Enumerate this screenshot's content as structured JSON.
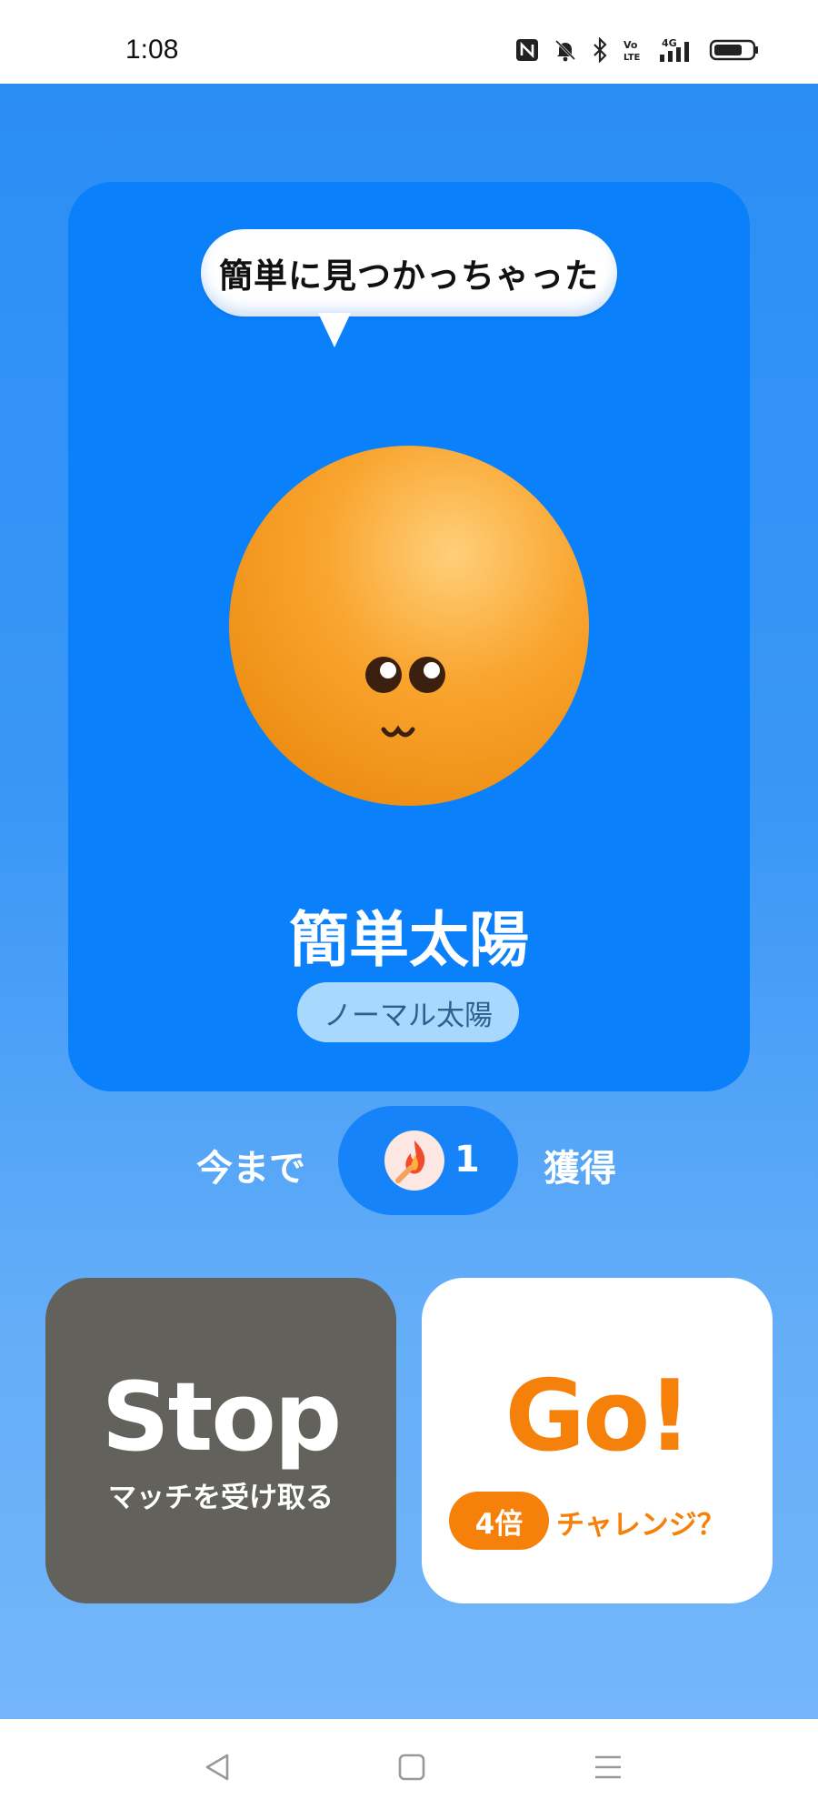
{
  "status_bar": {
    "time": "1:08",
    "icons": [
      "nfc-icon",
      "mute-bell-icon",
      "bluetooth-icon",
      "volte-icon",
      "signal-4g-icon",
      "battery-icon"
    ]
  },
  "character": {
    "speech": "簡単に見つかっちゃった",
    "name": "簡単太陽",
    "type": "ノーマル太陽"
  },
  "earned": {
    "prefix": "今まで",
    "count": "1",
    "suffix": "獲得",
    "icon": "match-flame-icon"
  },
  "stop_button": {
    "title": "Stop",
    "subtitle": "マッチを受け取る"
  },
  "go_button": {
    "title": "Go!",
    "multiplier": "4倍",
    "subtitle": "チャレンジ？"
  },
  "nav": {
    "items": [
      "back-icon",
      "home-icon",
      "menu-icon"
    ]
  },
  "colors": {
    "background_blue": "#2b8ef5",
    "card_blue": "#0a80fb",
    "stop_gray": "#62615b",
    "go_orange": "#f5800a",
    "type_pill": "#a9d8ff"
  }
}
